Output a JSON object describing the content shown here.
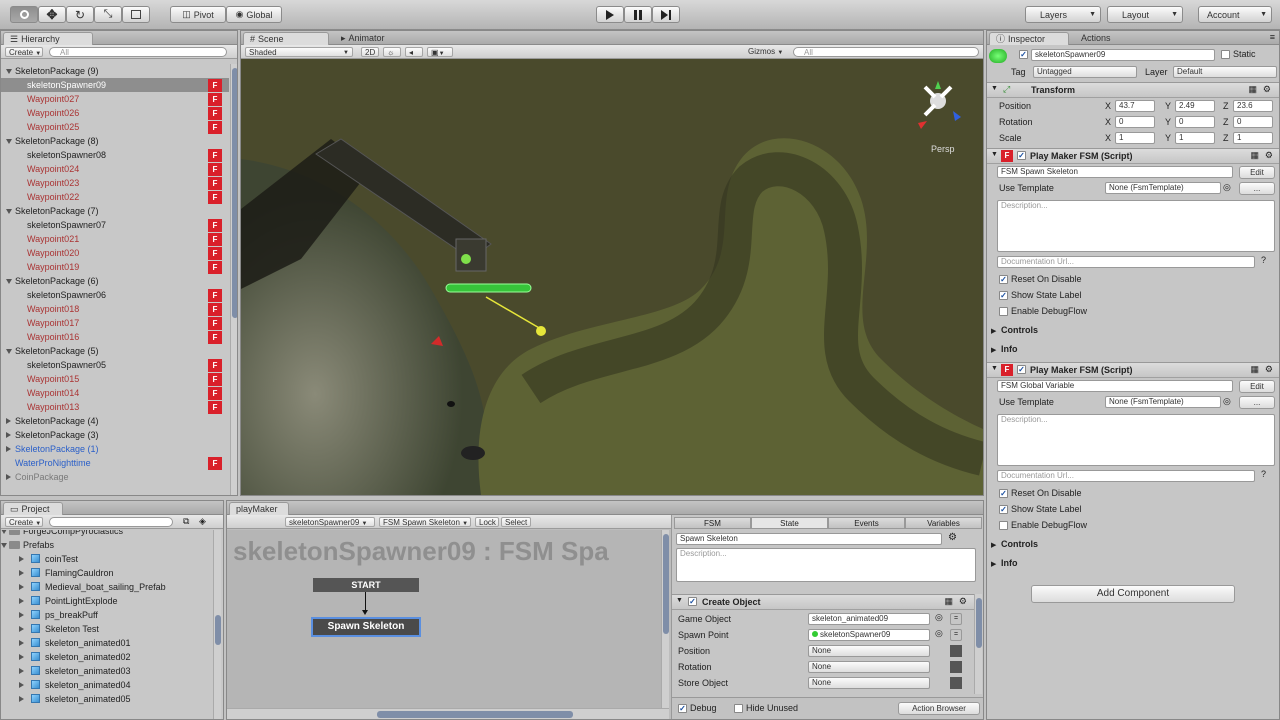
{
  "toolbar": {
    "pivot": "Pivot",
    "global": "Global",
    "layers": "Layers",
    "layout": "Layout",
    "account": "Account"
  },
  "hierarchy": {
    "tab": "Hierarchy",
    "create": "Create",
    "search_placeholder": "All",
    "rows": [
      {
        "text": "SkeletonPackage (9)",
        "indent": 0,
        "type": "group",
        "open": true,
        "icon": false
      },
      {
        "text": "skeletonSpawner09",
        "indent": 1,
        "type": "selected",
        "open": false,
        "icon": true
      },
      {
        "text": "Waypoint027",
        "indent": 1,
        "type": "red",
        "open": false,
        "icon": true
      },
      {
        "text": "Waypoint026",
        "indent": 1,
        "type": "red",
        "open": false,
        "icon": true
      },
      {
        "text": "Waypoint025",
        "indent": 1,
        "type": "red",
        "open": false,
        "icon": true
      },
      {
        "text": "SkeletonPackage (8)",
        "indent": 0,
        "type": "group",
        "open": true,
        "icon": false
      },
      {
        "text": "skeletonSpawner08",
        "indent": 1,
        "type": "normal",
        "open": false,
        "icon": true
      },
      {
        "text": "Waypoint024",
        "indent": 1,
        "type": "red",
        "open": false,
        "icon": true
      },
      {
        "text": "Waypoint023",
        "indent": 1,
        "type": "red",
        "open": false,
        "icon": true
      },
      {
        "text": "Waypoint022",
        "indent": 1,
        "type": "red",
        "open": false,
        "icon": true
      },
      {
        "text": "SkeletonPackage (7)",
        "indent": 0,
        "type": "group",
        "open": true,
        "icon": false
      },
      {
        "text": "skeletonSpawner07",
        "indent": 1,
        "type": "normal",
        "open": false,
        "icon": true
      },
      {
        "text": "Waypoint021",
        "indent": 1,
        "type": "red",
        "open": false,
        "icon": true
      },
      {
        "text": "Waypoint020",
        "indent": 1,
        "type": "red",
        "open": false,
        "icon": true
      },
      {
        "text": "Waypoint019",
        "indent": 1,
        "type": "red",
        "open": false,
        "icon": true
      },
      {
        "text": "SkeletonPackage (6)",
        "indent": 0,
        "type": "group",
        "open": true,
        "icon": false
      },
      {
        "text": "skeletonSpawner06",
        "indent": 1,
        "type": "normal",
        "open": false,
        "icon": true
      },
      {
        "text": "Waypoint018",
        "indent": 1,
        "type": "red",
        "open": false,
        "icon": true
      },
      {
        "text": "Waypoint017",
        "indent": 1,
        "type": "red",
        "open": false,
        "icon": true
      },
      {
        "text": "Waypoint016",
        "indent": 1,
        "type": "red",
        "open": false,
        "icon": true
      },
      {
        "text": "SkeletonPackage (5)",
        "indent": 0,
        "type": "group",
        "open": true,
        "icon": false
      },
      {
        "text": "skeletonSpawner05",
        "indent": 1,
        "type": "normal",
        "open": false,
        "icon": true
      },
      {
        "text": "Waypoint015",
        "indent": 1,
        "type": "red",
        "open": false,
        "icon": true
      },
      {
        "text": "Waypoint014",
        "indent": 1,
        "type": "red",
        "open": false,
        "icon": true
      },
      {
        "text": "Waypoint013",
        "indent": 1,
        "type": "red",
        "open": false,
        "icon": true
      },
      {
        "text": "SkeletonPackage (4)",
        "indent": 0,
        "type": "group",
        "open": false,
        "icon": false
      },
      {
        "text": "SkeletonPackage (3)",
        "indent": 0,
        "type": "group",
        "open": false,
        "icon": false
      },
      {
        "text": "SkeletonPackage (1)",
        "indent": 0,
        "type": "blue",
        "open": false,
        "icon": false
      },
      {
        "text": "WaterProNighttime",
        "indent": 0,
        "type": "blue",
        "open": false,
        "icon": true
      },
      {
        "text": "CoinPackage",
        "indent": 0,
        "type": "gray",
        "open": false,
        "icon": false
      }
    ]
  },
  "scene": {
    "tab_scene": "Scene",
    "tab_animator": "Animator",
    "shading": "Shaded",
    "mode_2d": "2D",
    "gizmos": "Gizmos",
    "search_placeholder": "All",
    "persp": "Persp"
  },
  "inspector": {
    "tab": "Inspector",
    "tab_actions": "Actions",
    "object_name": "skeletonSpawner09",
    "static": "Static",
    "tag_label": "Tag",
    "tag": "Untagged",
    "layer_label": "Layer",
    "layer": "Default",
    "transform": {
      "title": "Transform",
      "rows": [
        {
          "label": "Position",
          "x": "43.7",
          "y": "2.49",
          "z": "23.6"
        },
        {
          "label": "Rotation",
          "x": "0",
          "y": "0",
          "z": "0"
        },
        {
          "label": "Scale",
          "x": "1",
          "y": "1",
          "z": "1"
        }
      ]
    },
    "fsm_components": [
      {
        "title": "Play Maker FSM (Script)",
        "fsm_name": "FSM Spawn Skeleton",
        "edit": "Edit",
        "use_template": "Use Template",
        "template": "None (FsmTemplate)",
        "template_btn": "...",
        "description_placeholder": "Description...",
        "doc_url_placeholder": "Documentation Url...",
        "reset_on_disable": "Reset On Disable",
        "show_state_label": "Show State Label",
        "enable_debugflow": "Enable DebugFlow",
        "controls": "Controls",
        "info": "Info"
      },
      {
        "title": "Play Maker FSM (Script)",
        "fsm_name": "FSM Global Variable",
        "edit": "Edit",
        "use_template": "Use Template",
        "template": "None (FsmTemplate)",
        "template_btn": "...",
        "description_placeholder": "Description...",
        "doc_url_placeholder": "Documentation Url...",
        "reset_on_disable": "Reset On Disable",
        "show_state_label": "Show State Label",
        "enable_debugflow": "Enable DebugFlow",
        "controls": "Controls",
        "info": "Info"
      }
    ],
    "add_component": "Add Component"
  },
  "project": {
    "tab": "Project",
    "create": "Create",
    "items": [
      {
        "text": "ForgeJCompPyroclastics",
        "indent": 0,
        "folder": true
      },
      {
        "text": "Prefabs",
        "indent": 0,
        "folder": true
      },
      {
        "text": "coinTest",
        "indent": 1,
        "folder": false
      },
      {
        "text": "FlamingCauldron",
        "indent": 1,
        "folder": false
      },
      {
        "text": "Medieval_boat_sailing_Prefab",
        "indent": 1,
        "folder": false
      },
      {
        "text": "PointLightExplode",
        "indent": 1,
        "folder": false
      },
      {
        "text": "ps_breakPuff",
        "indent": 1,
        "folder": false
      },
      {
        "text": "Skeleton Test",
        "indent": 1,
        "folder": false
      },
      {
        "text": "skeleton_animated01",
        "indent": 1,
        "folder": false
      },
      {
        "text": "skeleton_animated02",
        "indent": 1,
        "folder": false
      },
      {
        "text": "skeleton_animated03",
        "indent": 1,
        "folder": false
      },
      {
        "text": "skeleton_animated04",
        "indent": 1,
        "folder": false
      },
      {
        "text": "skeleton_animated05",
        "indent": 1,
        "folder": false
      }
    ]
  },
  "playmaker": {
    "tab": "playMaker",
    "gameobject_select": "skeletonSpawner09",
    "fsm_select": "FSM Spawn Skeleton",
    "lock": "Lock",
    "select": "Select",
    "title": "skeletonSpawner09 : FSM Spa",
    "start_label": "START",
    "state_label": "Spawn Skeleton",
    "tabs": [
      "FSM",
      "State",
      "Events",
      "Variables"
    ],
    "state_name": "Spawn Skeleton",
    "description_placeholder": "Description...",
    "action_title": "Create Object",
    "action_rows": [
      {
        "label": "Game Object",
        "value": "skeleton_animated09"
      },
      {
        "label": "Spawn Point",
        "value": "skeletonSpawner09"
      },
      {
        "label": "Position",
        "value": "None"
      },
      {
        "label": "Rotation",
        "value": "None"
      },
      {
        "label": "Store Object",
        "value": "None"
      }
    ],
    "debug": "Debug",
    "hide_unused": "Hide Unused",
    "action_browser": "Action Browser"
  }
}
